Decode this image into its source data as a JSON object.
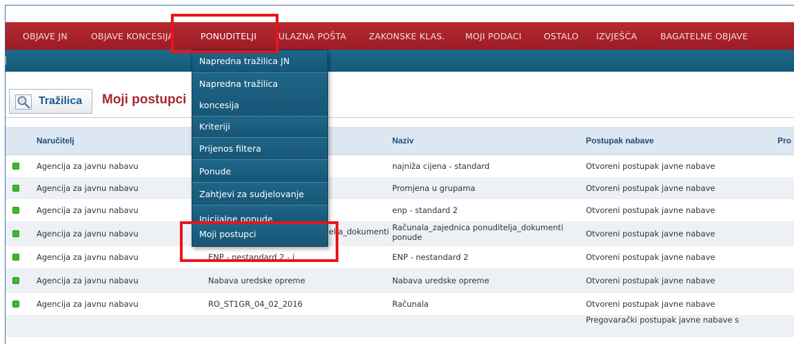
{
  "topnav": {
    "items": [
      {
        "label": "OBJAVE JN"
      },
      {
        "label": "OBJAVE KONCESIJA"
      },
      {
        "label": "PONUDITELJI"
      },
      {
        "label": "ULAZNA POŠTA"
      },
      {
        "label": "ZAKONSKE KLAS."
      },
      {
        "label": "MOJI PODACI"
      },
      {
        "label": "OSTALO"
      },
      {
        "label": "IZVJEŠĆA"
      },
      {
        "label": "BAGATELNE OBJAVE"
      }
    ]
  },
  "toolbar": {
    "search_label": "Tražilica",
    "page_title": "Moji postupci"
  },
  "dropdown": {
    "items": [
      {
        "label": "Napredna tražilica JN"
      },
      {
        "label": "Napredna tražilica",
        "label2": "koncesija"
      },
      {
        "label": "Kriteriji"
      },
      {
        "label": "Prijenos filtera"
      },
      {
        "label": "Ponude"
      },
      {
        "label": "Zahtjevi za sudjelovanje"
      },
      {
        "label": "Inicijalne ponude"
      },
      {
        "label": "Moji postupci"
      }
    ]
  },
  "table": {
    "headers": {
      "narucitelj": "Naručitelj",
      "naziv": "Naziv",
      "postupak": "Postupak nabave",
      "pro": "Pro"
    },
    "rows": [
      {
        "narucitelj": "Agencija za javnu nabavu",
        "col2": "",
        "naziv": "najniža cijena - standard",
        "postupak": "Otvoreni postupak javne nabave"
      },
      {
        "narucitelj": "Agencija za javnu nabavu",
        "col2": "",
        "naziv": "Promjena u grupama",
        "postupak": "Otvoreni postupak javne nabave"
      },
      {
        "narucitelj": "Agencija za javnu nabavu",
        "col2": "",
        "naziv": "enp - standard 2",
        "postupak": "Otvoreni postupak javne nabave"
      },
      {
        "narucitelj": "Agencija za javnu nabavu",
        "col2": "elja_dokumenti",
        "naziv": "Računala_zajednica ponuditelja_dokumenti",
        "naziv2": "ponude",
        "postupak": "Otvoreni postupak javne nabave"
      },
      {
        "narucitelj": "Agencija za javnu nabavu",
        "col2": "ENP - nestandard 2 - i",
        "naziv": "ENP - nestandard 2",
        "postupak": "Otvoreni postupak javne nabave"
      },
      {
        "narucitelj": "Agencija za javnu nabavu",
        "col2": "Nabava uredske opreme",
        "naziv": "Nabava uredske opreme",
        "postupak": "Otvoreni postupak javne nabave"
      },
      {
        "narucitelj": "Agencija za javnu nabavu",
        "col2": "RO_ST1GR_04_02_2016",
        "naziv": "Računala",
        "postupak": "Otvoreni postupak javne nabave"
      },
      {
        "narucitelj": "",
        "col2": "",
        "naziv": "",
        "postupak": "Pregovarački postupak javne nabave s"
      }
    ]
  },
  "colors": {
    "nav_red": "#a3212a",
    "sub_blue": "#1a5f80",
    "title_red": "#a52a30",
    "status_green": "#3cba2b",
    "highlight": "#e8141b"
  }
}
